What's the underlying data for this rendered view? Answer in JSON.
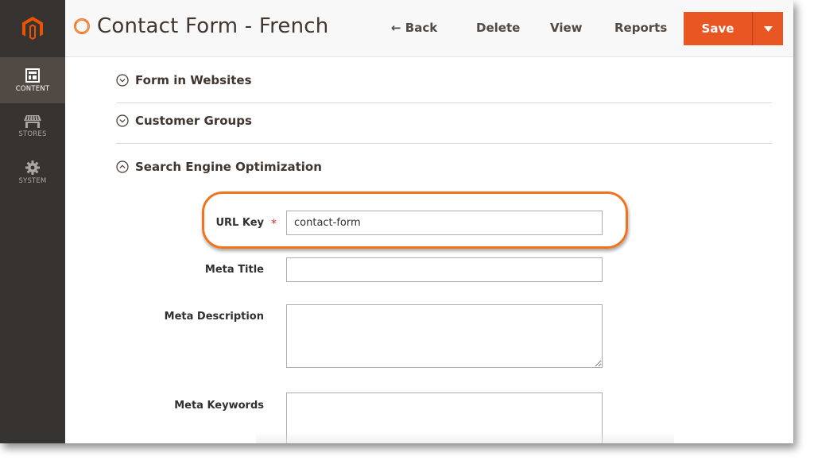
{
  "sidebar": {
    "logo": "magento-logo",
    "items": [
      {
        "label": "CONTENT",
        "icon": "content-layout-icon",
        "active": true
      },
      {
        "label": "STORES",
        "icon": "storefront-icon",
        "active": false
      },
      {
        "label": "SYSTEM",
        "icon": "gear-icon",
        "active": false
      }
    ]
  },
  "header": {
    "title": "Contact Form - French",
    "title_icon": "loading-spinner-icon",
    "back_label": "← Back",
    "delete_label": "Delete",
    "view_label": "View",
    "reports_label": "Reports",
    "save_label": "Save",
    "save_dropdown_icon": "caret-down-icon"
  },
  "sections": [
    {
      "title": "Form in Websites",
      "icon": "chevron-down-circle-icon",
      "expanded": false
    },
    {
      "title": "Customer Groups",
      "icon": "chevron-down-circle-icon",
      "expanded": false
    },
    {
      "title": "Search Engine Optimization",
      "icon": "chevron-up-circle-icon",
      "expanded": true
    }
  ],
  "seo_fields": {
    "url_key": {
      "label": "URL Key",
      "required_marker": "*",
      "value": "contact-form"
    },
    "meta_title": {
      "label": "Meta Title",
      "value": ""
    },
    "meta_description": {
      "label": "Meta Description",
      "value": ""
    },
    "meta_keywords": {
      "label": "Meta Keywords",
      "value": ""
    }
  },
  "colors": {
    "accent": "#e85624",
    "highlight": "#f0741e",
    "sidebar_bg": "#373330",
    "sidebar_active": "#514943"
  }
}
